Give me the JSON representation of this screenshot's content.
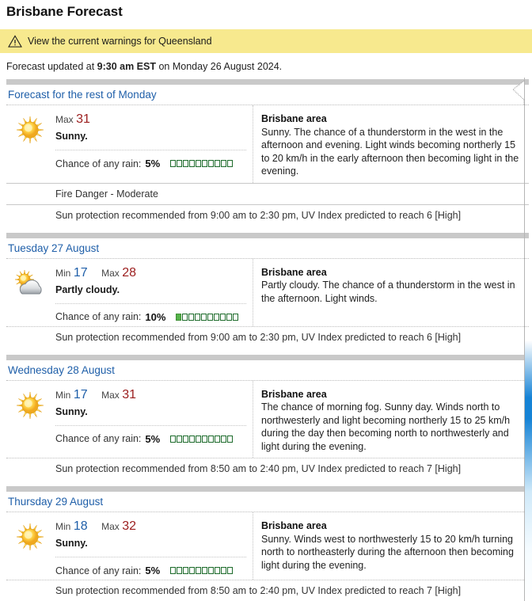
{
  "page": {
    "title": "Brisbane Forecast",
    "warning_link": "View the current warnings for Queensland",
    "warning_icon": "warning-triangle-icon",
    "updated_prefix": "Forecast updated at ",
    "updated_time": "9:30 am EST",
    "updated_suffix": " on Monday 26 August 2024."
  },
  "accent": {
    "heading_blue": "#1f5fa9",
    "min_blue": "#1f5fa9",
    "max_red": "#9b1d1d",
    "warning_yellow": "#f7e98e",
    "rain_green": "#1d6b2b",
    "rain_fill_green": "#55b349"
  },
  "labels": {
    "min": "Min",
    "max": "Max",
    "rain": "Chance of any rain:",
    "area": "Brisbane area"
  },
  "days": [
    {
      "heading": "Forecast for the rest of Monday",
      "icon": "sunny-icon",
      "show_min": false,
      "min": "",
      "max": "31",
      "precis": "Sunny.",
      "rain_pct": "5%",
      "rain_filled": 0,
      "rain_total": 10,
      "area": "Brisbane area",
      "description": "Sunny. The chance of a thunderstorm in the west in the afternoon and evening. Light winds becoming northerly 15 to 20 km/h in the early afternoon then becoming light in the evening.",
      "fire_danger": "Fire Danger - Moderate",
      "uv_note": "Sun protection recommended from 9:00 am to 2:30 pm, UV Index predicted to reach 6 [High]"
    },
    {
      "heading": "Tuesday 27 August",
      "icon": "partly-cloudy-icon",
      "show_min": true,
      "min": "17",
      "max": "28",
      "precis": "Partly cloudy.",
      "rain_pct": "10%",
      "rain_filled": 1,
      "rain_total": 10,
      "area": "Brisbane area",
      "description": "Partly cloudy. The chance of a thunderstorm in the west in the afternoon. Light winds.",
      "fire_danger": "",
      "uv_note": "Sun protection recommended from 9:00 am to 2:30 pm, UV Index predicted to reach 6 [High]"
    },
    {
      "heading": "Wednesday 28 August",
      "icon": "sunny-icon",
      "show_min": true,
      "min": "17",
      "max": "31",
      "precis": "Sunny.",
      "rain_pct": "5%",
      "rain_filled": 0,
      "rain_total": 10,
      "area": "Brisbane area",
      "description": "The chance of morning fog. Sunny day. Winds north to northwesterly and light becoming northerly 15 to 25 km/h during the day then becoming north to northwesterly and light during the evening.",
      "fire_danger": "",
      "uv_note": "Sun protection recommended from 8:50 am to 2:40 pm, UV Index predicted to reach 7 [High]"
    },
    {
      "heading": "Thursday 29 August",
      "icon": "sunny-icon",
      "show_min": true,
      "min": "18",
      "max": "32",
      "precis": "Sunny.",
      "rain_pct": "5%",
      "rain_filled": 0,
      "rain_total": 10,
      "area": "Brisbane area",
      "description": "Sunny. Winds west to northwesterly 15 to 20 km/h turning north to northeasterly during the afternoon then becoming light during the evening.",
      "fire_danger": "",
      "uv_note": "Sun protection recommended from 8:50 am to 2:40 pm, UV Index predicted to reach 7 [High]"
    }
  ]
}
